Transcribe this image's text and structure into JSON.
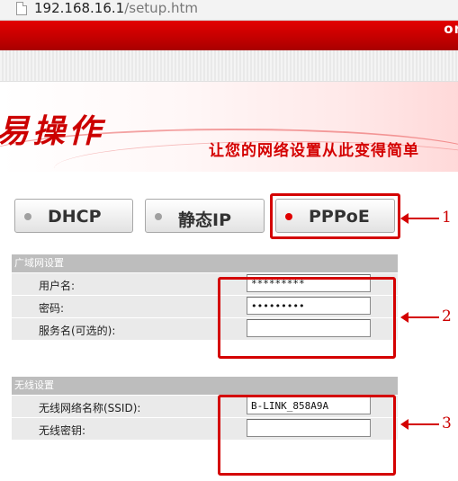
{
  "browser": {
    "url_host": "192.168.16.1",
    "url_path": "/setup.htm"
  },
  "header": {
    "brand_fragment": "or",
    "title": "易操作",
    "slogan": "让您的网络设置从此变得简单"
  },
  "modes": [
    {
      "label": "DHCP",
      "selected": false
    },
    {
      "label": "静态IP",
      "selected": false
    },
    {
      "label": "PPPoE",
      "selected": true
    }
  ],
  "wan": {
    "heading": "广域网设置",
    "username_label": "用户名:",
    "username_value": "*********",
    "password_label": "密码:",
    "password_value": "•••••••••",
    "service_label": "服务名(可选的):",
    "service_value": ""
  },
  "wireless": {
    "heading": "无线设置",
    "ssid_label": "无线网络名称(SSID):",
    "ssid_value": "B-LINK_858A9A",
    "key_label": "无线密钥:",
    "key_value": ""
  },
  "annotations": [
    "1",
    "2",
    "3"
  ],
  "colors": {
    "accent_red": "#d40000",
    "section_header": "#bdbdbd",
    "row_background": "#eaeaea"
  }
}
